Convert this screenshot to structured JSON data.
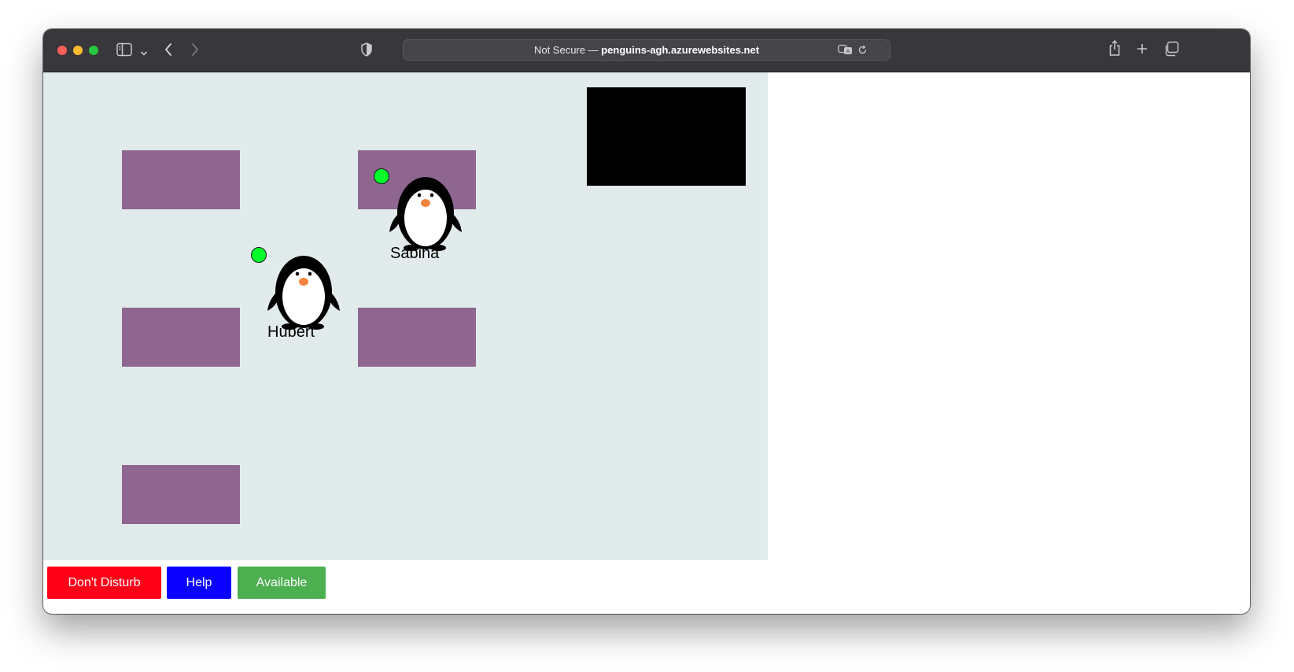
{
  "browser": {
    "address_prefix": "Not Secure — ",
    "address_host": "penguins-agh.azurewebsites.net"
  },
  "office": {
    "background_color": "#e1ebeb",
    "desk_color": "#8e6690",
    "screen_color": "#000000",
    "users": [
      {
        "name": "Hubert",
        "status_color": "#00ff2a"
      },
      {
        "name": "Sabina",
        "status_color": "#00ff2a"
      }
    ]
  },
  "status_buttons": [
    {
      "label": "Don't Disturb",
      "color": "#ff0018"
    },
    {
      "label": "Help",
      "color": "#0a00ff"
    },
    {
      "label": "Available",
      "color": "#4caf50"
    }
  ]
}
